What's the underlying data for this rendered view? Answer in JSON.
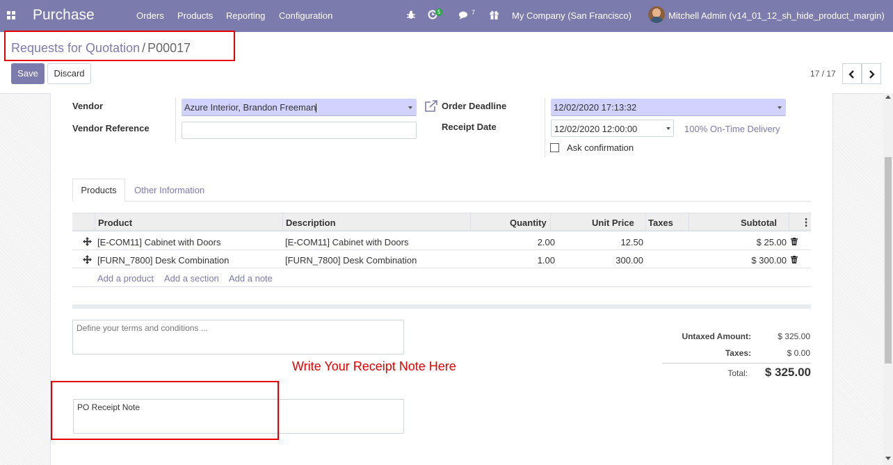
{
  "navbar": {
    "app_title": "Purchase",
    "menu": [
      "Orders",
      "Products",
      "Reporting",
      "Configuration"
    ],
    "activity_count": "5",
    "message_count": "7",
    "company": "My Company (San Francisco)",
    "user": "Mitchell Admin (v14_01_12_sh_hide_product_margin)",
    "icons": [
      "apps-icon",
      "bug-icon",
      "activity-clock-icon",
      "chat-icon",
      "gift-icon",
      "avatar"
    ]
  },
  "breadcrumb": {
    "parent": "Requests for Quotation",
    "separator": "/",
    "current": "P00017"
  },
  "buttons": {
    "save": "Save",
    "discard": "Discard"
  },
  "pager": {
    "value": "17 / 17"
  },
  "form": {
    "vendor_label": "Vendor",
    "vendor_value": "Azure Interior, Brandon Freeman",
    "vendor_reference_label": "Vendor Reference",
    "vendor_reference_value": "",
    "order_deadline_label": "Order Deadline",
    "order_deadline_value": "12/02/2020 17:13:32",
    "receipt_date_label": "Receipt Date",
    "receipt_date_value": "12/02/2020 12:00:00",
    "on_time_delivery": "100% On-Time Delivery",
    "ask_confirmation_label": "Ask confirmation",
    "ask_confirmation_checked": false
  },
  "tabs": {
    "active": "Products",
    "other": "Other Information"
  },
  "table": {
    "headers": {
      "product": "Product",
      "description": "Description",
      "quantity": "Quantity",
      "unit_price": "Unit Price",
      "taxes": "Taxes",
      "subtotal": "Subtotal"
    },
    "rows": [
      {
        "product": "[E-COM11] Cabinet with Doors",
        "description": "[E-COM11] Cabinet with Doors",
        "quantity": "2.00",
        "unit_price": "12.50",
        "taxes": "",
        "subtotal": "$ 25.00"
      },
      {
        "product": "[FURN_7800] Desk Combination",
        "description": "[FURN_7800] Desk Combination",
        "quantity": "1.00",
        "unit_price": "300.00",
        "taxes": "",
        "subtotal": "$ 300.00"
      }
    ],
    "add_links": {
      "product": "Add a product",
      "section": "Add a section",
      "note": "Add a note"
    }
  },
  "notes": {
    "terms_placeholder": "Define your terms and conditions ...",
    "annotation": "Write Your Receipt Note Here",
    "receipt_note_value": "PO Receipt Note"
  },
  "totals": {
    "untaxed_label": "Untaxed Amount:",
    "untaxed_value": "$ 325.00",
    "taxes_label": "Taxes:",
    "taxes_value": "$ 0.00",
    "total_label": "Total:",
    "total_value": "$ 325.00"
  },
  "colors": {
    "brand": "#7c7bad",
    "required_field": "#d2d2ff",
    "annotation_red": "#e60000"
  }
}
